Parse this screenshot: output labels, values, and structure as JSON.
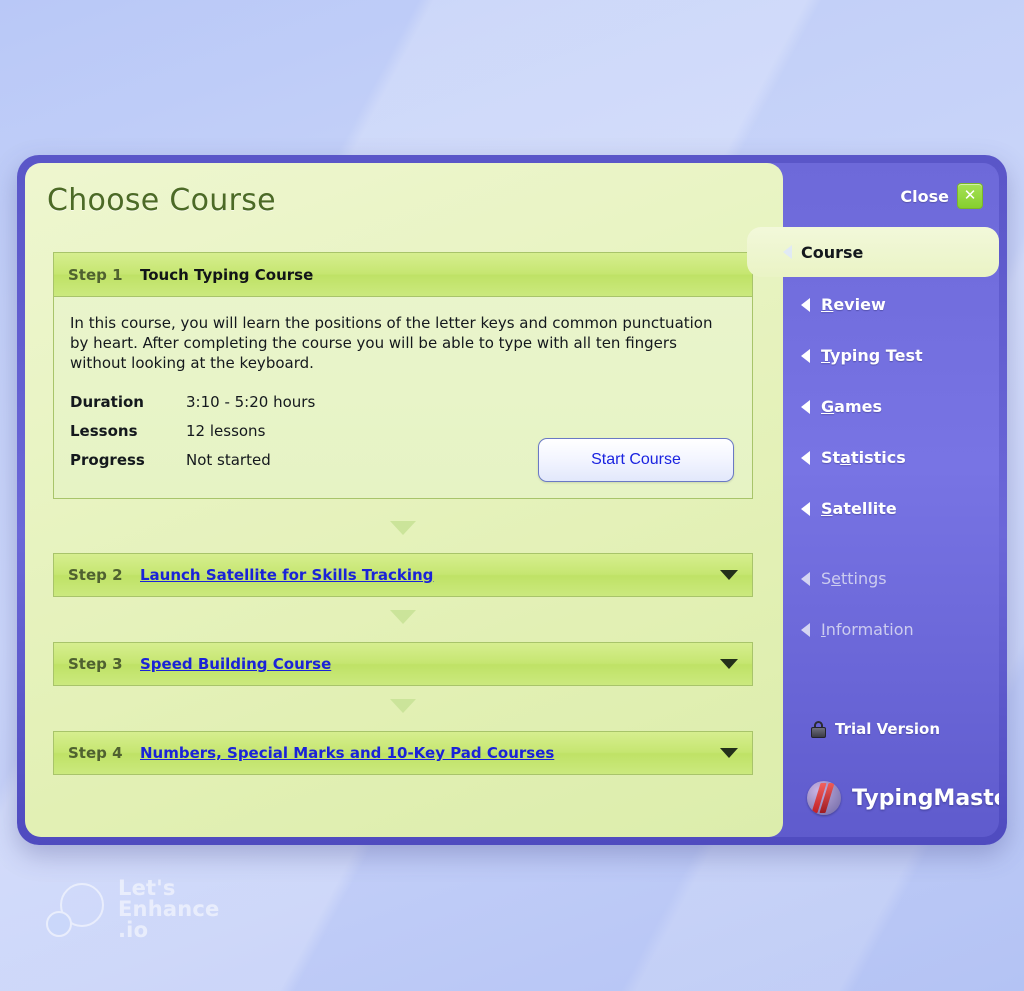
{
  "window": {
    "title": "Choose Course",
    "close_label": "Close",
    "close_icon": "close-x-icon"
  },
  "step1": {
    "step_label": "Step 1",
    "title": "Touch Typing Course",
    "description": "In this course, you will learn the positions of the letter keys and common punctuation by heart. After completing the course you will be able to type with all ten fingers without looking at the keyboard.",
    "details": [
      {
        "key": "Duration",
        "value": "3:10 - 5:20 hours"
      },
      {
        "key": "Lessons",
        "value": "12 lessons"
      },
      {
        "key": "Progress",
        "value": "Not started"
      }
    ],
    "start_button": "Start Course"
  },
  "steps": [
    {
      "step_label": "Step 2",
      "title": "Launch Satellite for Skills Tracking"
    },
    {
      "step_label": "Step 3",
      "title": "Speed Building Course"
    },
    {
      "step_label": "Step 4",
      "title": "Numbers, Special Marks and 10-Key Pad Courses"
    }
  ],
  "sidebar": {
    "active_tab": "Course",
    "items": [
      {
        "label": "Review",
        "accel": "R",
        "disabled": false
      },
      {
        "label": "Typing Test",
        "accel": "T",
        "disabled": false
      },
      {
        "label": "Games",
        "accel": "G",
        "disabled": false
      },
      {
        "label": "Statistics",
        "accel": "a",
        "disabled": false
      },
      {
        "label": "Satellite",
        "accel": "S",
        "disabled": false
      },
      {
        "label": "Settings",
        "accel": "e",
        "disabled": true
      },
      {
        "label": "Information",
        "accel": "I",
        "disabled": true
      }
    ],
    "trial_label": "Trial Version",
    "brand": "TypingMaster"
  },
  "watermark": {
    "line1": "Let's",
    "line2": "Enhance",
    "line3": ".io"
  },
  "colors": {
    "window_border": "#5a56c8",
    "sidebar": "#7874e4",
    "content_panel": "#e6f3c4",
    "step_header": "#c6e671",
    "link": "#1a23d8",
    "title": "#4c6a26",
    "close_green": "#86cf2e"
  }
}
